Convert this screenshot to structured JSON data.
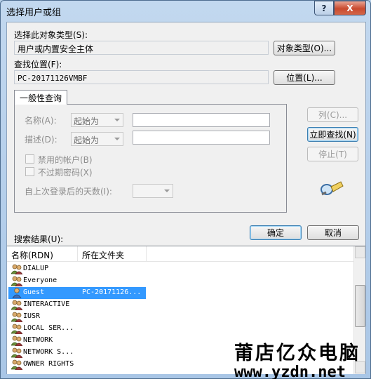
{
  "window": {
    "title": "选择用户或组",
    "help_label": "?",
    "close_label": "X"
  },
  "object_type": {
    "label": "选择此对象类型(S):",
    "value": "用户或内置安全主体",
    "button": "对象类型(O)..."
  },
  "location": {
    "label": "查找位置(F):",
    "value": "PC-20171126VMBF",
    "button": "位置(L)..."
  },
  "tab": {
    "label": "一般性查询"
  },
  "query": {
    "name_label": "名称(A):",
    "name_mode": "起始为",
    "desc_label": "描述(D):",
    "desc_mode": "起始为",
    "disabled_accounts": "禁用的帐户(B)",
    "non_expiring": "不过期密码(X)",
    "days_label": "自上次登录后的天数(I):",
    "days_value": ""
  },
  "side_buttons": {
    "columns": "列(C)...",
    "find_now": "立即查找(N)",
    "stop": "停止(T)"
  },
  "ok_label": "确定",
  "cancel_label": "取消",
  "results": {
    "label": "搜索结果(U):",
    "columns": [
      "名称(RDN)",
      "所在文件夹"
    ],
    "rows": [
      {
        "name": "DIALUP",
        "folder": "",
        "icon": "group-icon"
      },
      {
        "name": "Everyone",
        "folder": "",
        "icon": "group-icon"
      },
      {
        "name": "Guest",
        "folder": "PC-20171126...",
        "icon": "user-icon",
        "selected": true
      },
      {
        "name": "INTERACTIVE",
        "folder": "",
        "icon": "group-icon"
      },
      {
        "name": "IUSR",
        "folder": "",
        "icon": "group-icon"
      },
      {
        "name": "LOCAL SER...",
        "folder": "",
        "icon": "group-icon"
      },
      {
        "name": "NETWORK",
        "folder": "",
        "icon": "group-icon"
      },
      {
        "name": "NETWORK S...",
        "folder": "",
        "icon": "group-icon"
      },
      {
        "name": "OWNER RIGHTS",
        "folder": "",
        "icon": "group-icon"
      }
    ]
  },
  "watermark": {
    "title": "莆店亿众电脑",
    "url": "www.yzdn.net"
  }
}
